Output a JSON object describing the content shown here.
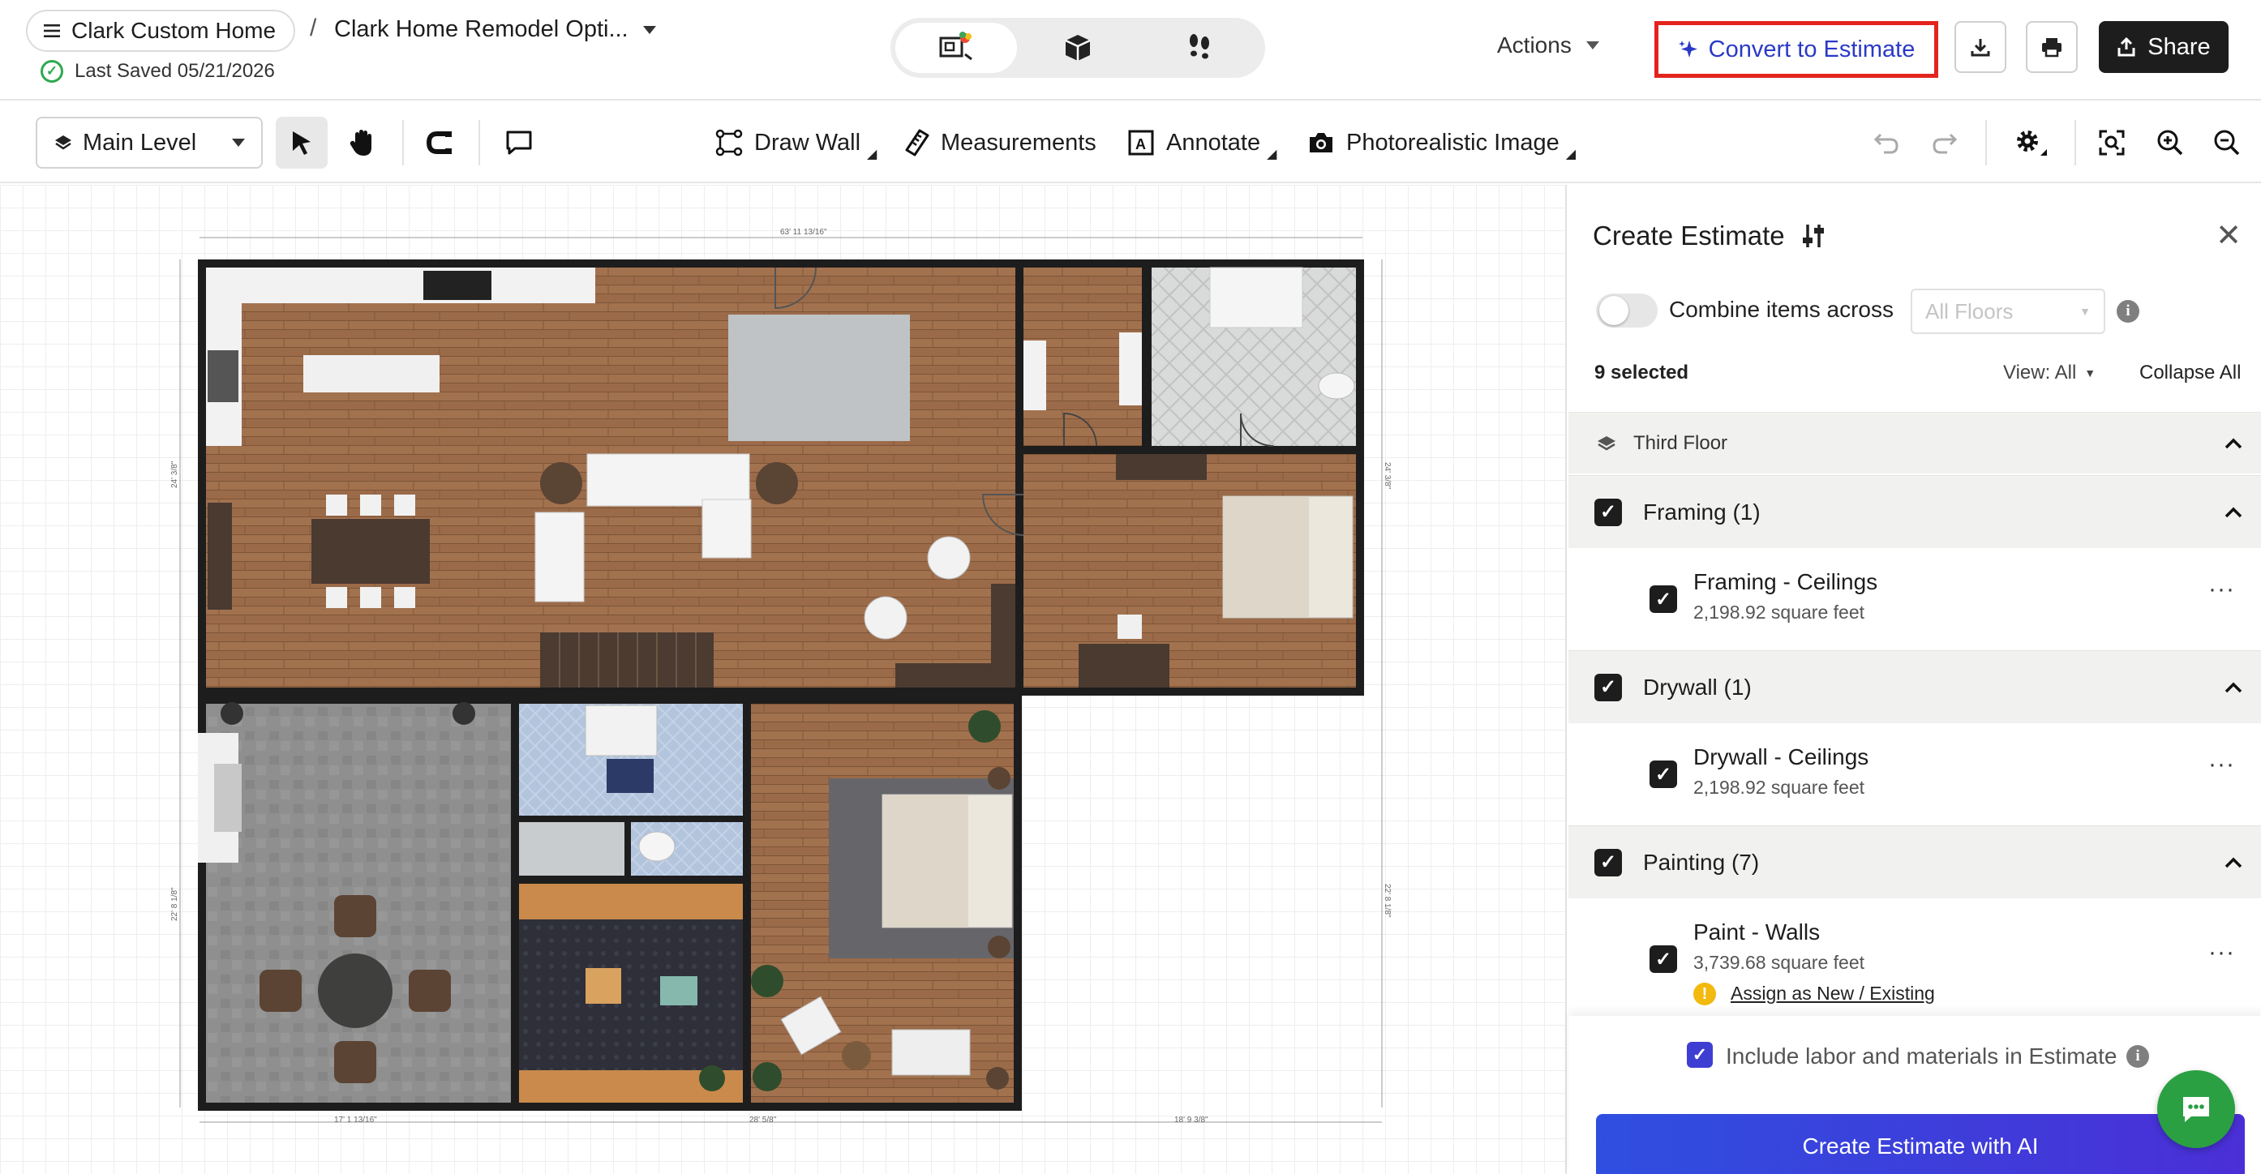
{
  "header": {
    "project_menu_label": "Clark Custom Home",
    "separator": "/",
    "design_name": "Clark Home Remodel Opti...",
    "last_saved": "Last Saved 05/21/2026",
    "actions_label": "Actions",
    "convert_label": "Convert to Estimate",
    "share_label": "Share"
  },
  "toolbar": {
    "level": "Main Level",
    "draw_wall": "Draw Wall",
    "measurements": "Measurements",
    "annotate": "Annotate",
    "photo": "Photorealistic Image"
  },
  "plan": {
    "dim_top": "63' 11 13/16\"",
    "dim_left_upper": "24' 3/8\"",
    "dim_left_lower": "22' 8 1/8\"",
    "dim_right_upper": "24' 3/8\"",
    "dim_right_lower": "22' 8 1/8\"",
    "dim_bottom_1": "17' 1 13/16\"",
    "dim_bottom_2": "28' 5/8\"",
    "dim_bottom_3": "18' 9 3/8\""
  },
  "panel": {
    "title": "Create Estimate",
    "combine_label": "Combine items across",
    "floors_placeholder": "All Floors",
    "selected": "9 selected",
    "view_filter": "View: All",
    "collapse_all": "Collapse All",
    "floor": "Third Floor",
    "groups": [
      {
        "label": "Framing (1)",
        "items": [
          {
            "name": "Framing - Ceilings",
            "qty": "2,198.92 square feet"
          }
        ]
      },
      {
        "label": "Drywall (1)",
        "items": [
          {
            "name": "Drywall - Ceilings",
            "qty": "2,198.92 square feet"
          }
        ]
      },
      {
        "label": "Painting (7)",
        "items": [
          {
            "name": "Paint - Walls",
            "qty": "3,739.68 square feet",
            "warning": "Assign as New / Existing"
          }
        ]
      }
    ],
    "include_label": "Include labor and materials in Estimate",
    "create_button": "Create Estimate with AI"
  },
  "colors": {
    "accent": "#2b39c7",
    "highlight_border": "#e3241e",
    "create_gradient_start": "#2f4fe0",
    "chat": "#2aa043",
    "wood": "#9b6b49",
    "stone": "#8c8c8c"
  }
}
